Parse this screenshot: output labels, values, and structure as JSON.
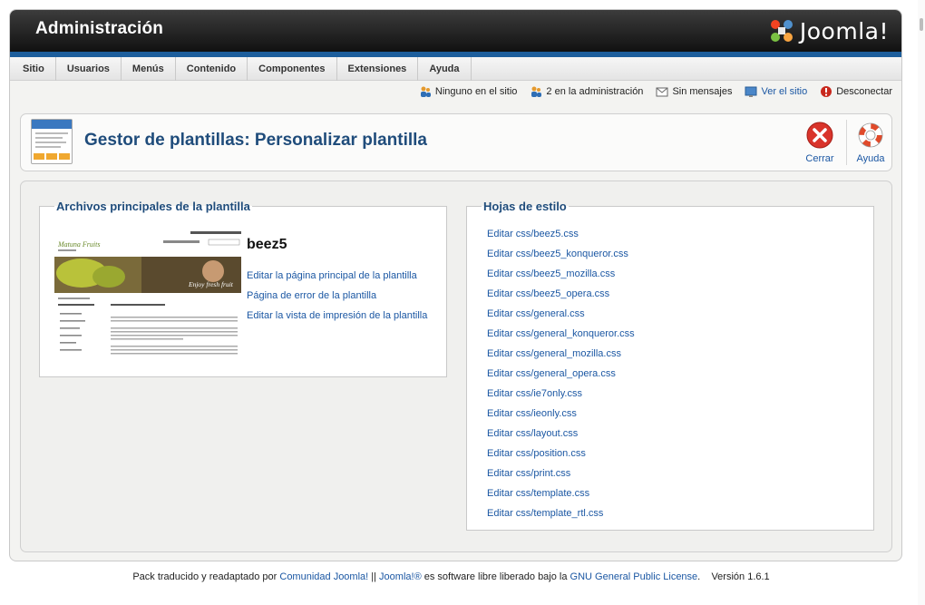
{
  "app": {
    "title": "Administración",
    "logo_text": "Joomla!"
  },
  "menu": [
    "Sitio",
    "Usuarios",
    "Menús",
    "Contenido",
    "Componentes",
    "Extensiones",
    "Ayuda"
  ],
  "status": {
    "visitors": "Ninguno en el sitio",
    "admins": "2 en la administración",
    "messages": "Sin mensajes",
    "view_site": "Ver el sitio",
    "logout": "Desconectar"
  },
  "header": {
    "title": "Gestor de plantillas: Personalizar plantilla",
    "close_label": "Cerrar",
    "help_label": "Ayuda"
  },
  "main_files": {
    "legend": "Archivos principales de la plantilla",
    "template_name": "beez5",
    "links": [
      "Editar la página principal de la plantilla",
      "Página de error de la plantilla",
      "Editar la vista de impresión de la plantilla"
    ],
    "preview": {
      "site_name": "Matuna Fruits",
      "banner_text": "Enjoy fresh fruit"
    }
  },
  "stylesheets": {
    "legend": "Hojas de estilo",
    "links": [
      "Editar css/beez5.css",
      "Editar css/beez5_konqueror.css",
      "Editar css/beez5_mozilla.css",
      "Editar css/beez5_opera.css",
      "Editar css/general.css",
      "Editar css/general_konqueror.css",
      "Editar css/general_mozilla.css",
      "Editar css/general_opera.css",
      "Editar css/ie7only.css",
      "Editar css/ieonly.css",
      "Editar css/layout.css",
      "Editar css/position.css",
      "Editar css/print.css",
      "Editar css/template.css",
      "Editar css/template_rtl.css"
    ]
  },
  "footer": {
    "prefix": "Pack traducido y readaptado por ",
    "community_link": "Comunidad Joomla!",
    "sep": " || ",
    "joomla_link": "Joomla!®",
    "middle": " es software libre liberado bajo la ",
    "license_link": "GNU General Public License",
    "version": ".    Versión 1.6.1"
  },
  "colors": {
    "accent_blue": "#1d5e9c",
    "link": "#1b57a3",
    "title": "#1f4c7b",
    "close_red": "#d9342b"
  }
}
